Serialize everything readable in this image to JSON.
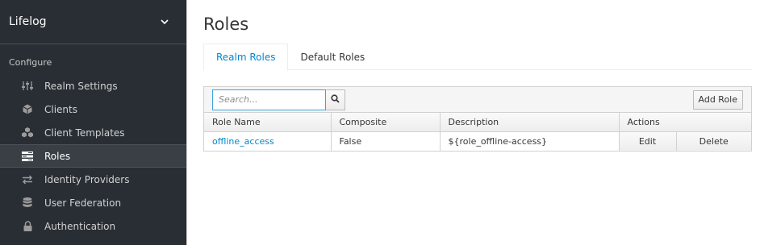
{
  "sidebar": {
    "realm": "Lifelog",
    "section_label": "Configure",
    "items": [
      {
        "label": "Realm Settings",
        "icon": "sliders-icon"
      },
      {
        "label": "Clients",
        "icon": "cube-icon"
      },
      {
        "label": "Client Templates",
        "icon": "cubes-icon"
      },
      {
        "label": "Roles",
        "icon": "roles-icon"
      },
      {
        "label": "Identity Providers",
        "icon": "exchange-icon"
      },
      {
        "label": "User Federation",
        "icon": "database-icon"
      },
      {
        "label": "Authentication",
        "icon": "lock-icon"
      }
    ],
    "active_index": 3
  },
  "main": {
    "title": "Roles",
    "tabs": [
      {
        "label": "Realm Roles",
        "active": true
      },
      {
        "label": "Default Roles",
        "active": false
      }
    ],
    "search": {
      "placeholder": "Search...",
      "value": ""
    },
    "add_button": "Add Role",
    "table": {
      "columns": [
        "Role Name",
        "Composite",
        "Description",
        "Actions"
      ],
      "rows": [
        {
          "name": "offline_access",
          "composite": "False",
          "description": "${role_offline-access}",
          "edit": "Edit",
          "delete": "Delete"
        }
      ]
    }
  },
  "colors": {
    "sidebar_bg": "#292e34",
    "accent": "#0088ce",
    "active_item_bg": "#393f44"
  }
}
